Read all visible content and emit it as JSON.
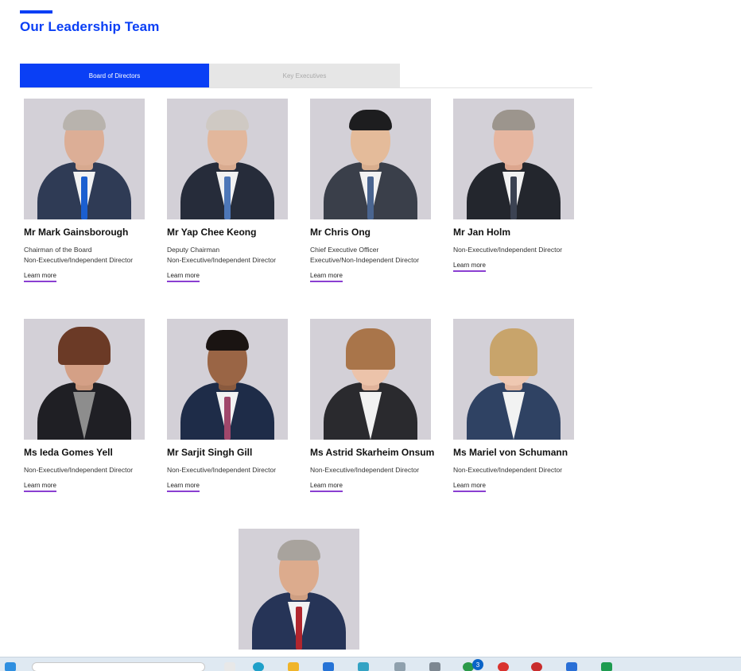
{
  "header": {
    "title": "Our Leadership Team"
  },
  "tabs": [
    {
      "label": "Board of Directors",
      "active": true
    },
    {
      "label": "Key Executives",
      "active": false
    }
  ],
  "learn_more_label": "Learn more",
  "directors": [
    {
      "name": "Mr Mark Gainsborough",
      "roles": [
        "Chairman of the Board",
        "Non-Executive/Independent Director"
      ]
    },
    {
      "name": "Mr Yap Chee Keong",
      "roles": [
        "Deputy Chairman",
        "Non-Executive/Independent Director"
      ]
    },
    {
      "name": "Mr Chris Ong",
      "roles": [
        "Chief Executive Officer",
        "Executive/Non-Independent Director"
      ]
    },
    {
      "name": "Mr Jan Holm",
      "roles": [
        "Non-Executive/Independent Director"
      ]
    },
    {
      "name": "Ms Ieda Gomes Yell",
      "roles": [
        "Non-Executive/Independent Director"
      ]
    },
    {
      "name": "Mr Sarjit Singh Gill",
      "roles": [
        "Non-Executive/Independent Director"
      ]
    },
    {
      "name": "Ms Astrid Skarheim Onsum",
      "roles": [
        "Non-Executive/Independent Director"
      ]
    },
    {
      "name": "Ms Mariel von Schumann",
      "roles": [
        "Non-Executive/Independent Director"
      ]
    }
  ],
  "taskbar": {
    "notification_count": "3"
  },
  "colors": {
    "brand_blue": "#0a3ff5",
    "link_underline": "#8a3fd1",
    "photo_bg": "#d3d0d7"
  }
}
